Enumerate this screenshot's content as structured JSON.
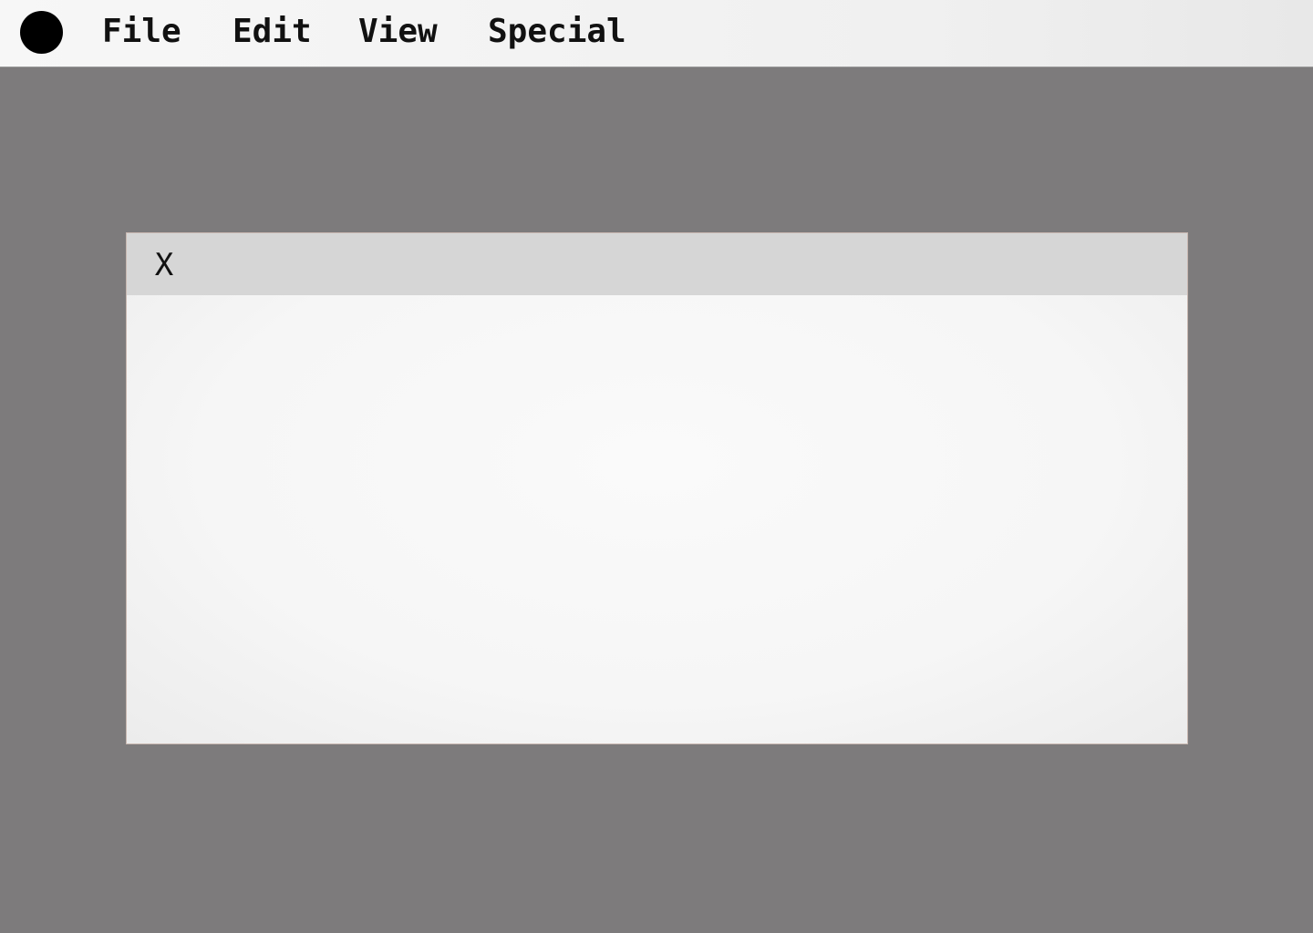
{
  "menubar": {
    "apple_icon": "filled-circle-icon",
    "items": [
      {
        "label": "File"
      },
      {
        "label": "Edit"
      },
      {
        "label": "View"
      },
      {
        "label": "Special"
      }
    ]
  },
  "window": {
    "close_label": "X"
  },
  "colors": {
    "desktop": "#7d7b7c",
    "menubar": "#f0f0f0",
    "titlebar": "#d6d6d6",
    "window_body": "#f7f7f7"
  }
}
